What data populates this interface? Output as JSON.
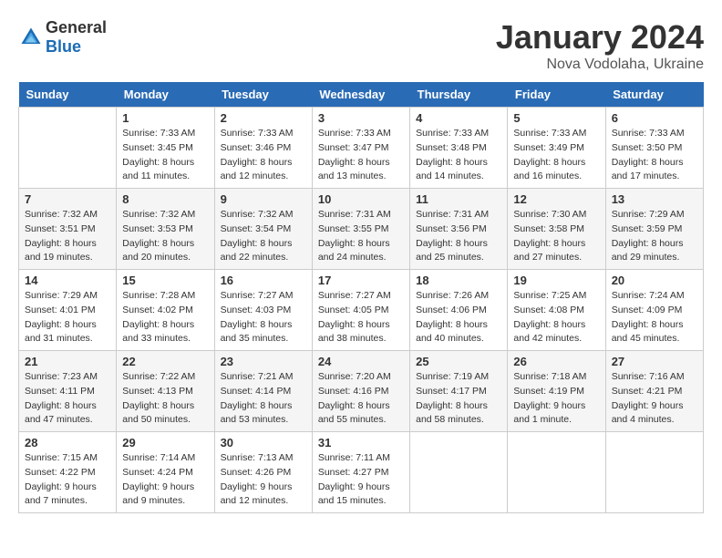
{
  "header": {
    "logo_general": "General",
    "logo_blue": "Blue",
    "month_title": "January 2024",
    "location": "Nova Vodolaha, Ukraine"
  },
  "weekdays": [
    "Sunday",
    "Monday",
    "Tuesday",
    "Wednesday",
    "Thursday",
    "Friday",
    "Saturday"
  ],
  "weeks": [
    [
      {
        "day": "",
        "info": ""
      },
      {
        "day": "1",
        "info": "Sunrise: 7:33 AM\nSunset: 3:45 PM\nDaylight: 8 hours\nand 11 minutes."
      },
      {
        "day": "2",
        "info": "Sunrise: 7:33 AM\nSunset: 3:46 PM\nDaylight: 8 hours\nand 12 minutes."
      },
      {
        "day": "3",
        "info": "Sunrise: 7:33 AM\nSunset: 3:47 PM\nDaylight: 8 hours\nand 13 minutes."
      },
      {
        "day": "4",
        "info": "Sunrise: 7:33 AM\nSunset: 3:48 PM\nDaylight: 8 hours\nand 14 minutes."
      },
      {
        "day": "5",
        "info": "Sunrise: 7:33 AM\nSunset: 3:49 PM\nDaylight: 8 hours\nand 16 minutes."
      },
      {
        "day": "6",
        "info": "Sunrise: 7:33 AM\nSunset: 3:50 PM\nDaylight: 8 hours\nand 17 minutes."
      }
    ],
    [
      {
        "day": "7",
        "info": "Sunrise: 7:32 AM\nSunset: 3:51 PM\nDaylight: 8 hours\nand 19 minutes."
      },
      {
        "day": "8",
        "info": "Sunrise: 7:32 AM\nSunset: 3:53 PM\nDaylight: 8 hours\nand 20 minutes."
      },
      {
        "day": "9",
        "info": "Sunrise: 7:32 AM\nSunset: 3:54 PM\nDaylight: 8 hours\nand 22 minutes."
      },
      {
        "day": "10",
        "info": "Sunrise: 7:31 AM\nSunset: 3:55 PM\nDaylight: 8 hours\nand 24 minutes."
      },
      {
        "day": "11",
        "info": "Sunrise: 7:31 AM\nSunset: 3:56 PM\nDaylight: 8 hours\nand 25 minutes."
      },
      {
        "day": "12",
        "info": "Sunrise: 7:30 AM\nSunset: 3:58 PM\nDaylight: 8 hours\nand 27 minutes."
      },
      {
        "day": "13",
        "info": "Sunrise: 7:29 AM\nSunset: 3:59 PM\nDaylight: 8 hours\nand 29 minutes."
      }
    ],
    [
      {
        "day": "14",
        "info": "Sunrise: 7:29 AM\nSunset: 4:01 PM\nDaylight: 8 hours\nand 31 minutes."
      },
      {
        "day": "15",
        "info": "Sunrise: 7:28 AM\nSunset: 4:02 PM\nDaylight: 8 hours\nand 33 minutes."
      },
      {
        "day": "16",
        "info": "Sunrise: 7:27 AM\nSunset: 4:03 PM\nDaylight: 8 hours\nand 35 minutes."
      },
      {
        "day": "17",
        "info": "Sunrise: 7:27 AM\nSunset: 4:05 PM\nDaylight: 8 hours\nand 38 minutes."
      },
      {
        "day": "18",
        "info": "Sunrise: 7:26 AM\nSunset: 4:06 PM\nDaylight: 8 hours\nand 40 minutes."
      },
      {
        "day": "19",
        "info": "Sunrise: 7:25 AM\nSunset: 4:08 PM\nDaylight: 8 hours\nand 42 minutes."
      },
      {
        "day": "20",
        "info": "Sunrise: 7:24 AM\nSunset: 4:09 PM\nDaylight: 8 hours\nand 45 minutes."
      }
    ],
    [
      {
        "day": "21",
        "info": "Sunrise: 7:23 AM\nSunset: 4:11 PM\nDaylight: 8 hours\nand 47 minutes."
      },
      {
        "day": "22",
        "info": "Sunrise: 7:22 AM\nSunset: 4:13 PM\nDaylight: 8 hours\nand 50 minutes."
      },
      {
        "day": "23",
        "info": "Sunrise: 7:21 AM\nSunset: 4:14 PM\nDaylight: 8 hours\nand 53 minutes."
      },
      {
        "day": "24",
        "info": "Sunrise: 7:20 AM\nSunset: 4:16 PM\nDaylight: 8 hours\nand 55 minutes."
      },
      {
        "day": "25",
        "info": "Sunrise: 7:19 AM\nSunset: 4:17 PM\nDaylight: 8 hours\nand 58 minutes."
      },
      {
        "day": "26",
        "info": "Sunrise: 7:18 AM\nSunset: 4:19 PM\nDaylight: 9 hours\nand 1 minute."
      },
      {
        "day": "27",
        "info": "Sunrise: 7:16 AM\nSunset: 4:21 PM\nDaylight: 9 hours\nand 4 minutes."
      }
    ],
    [
      {
        "day": "28",
        "info": "Sunrise: 7:15 AM\nSunset: 4:22 PM\nDaylight: 9 hours\nand 7 minutes."
      },
      {
        "day": "29",
        "info": "Sunrise: 7:14 AM\nSunset: 4:24 PM\nDaylight: 9 hours\nand 9 minutes."
      },
      {
        "day": "30",
        "info": "Sunrise: 7:13 AM\nSunset: 4:26 PM\nDaylight: 9 hours\nand 12 minutes."
      },
      {
        "day": "31",
        "info": "Sunrise: 7:11 AM\nSunset: 4:27 PM\nDaylight: 9 hours\nand 15 minutes."
      },
      {
        "day": "",
        "info": ""
      },
      {
        "day": "",
        "info": ""
      },
      {
        "day": "",
        "info": ""
      }
    ]
  ]
}
